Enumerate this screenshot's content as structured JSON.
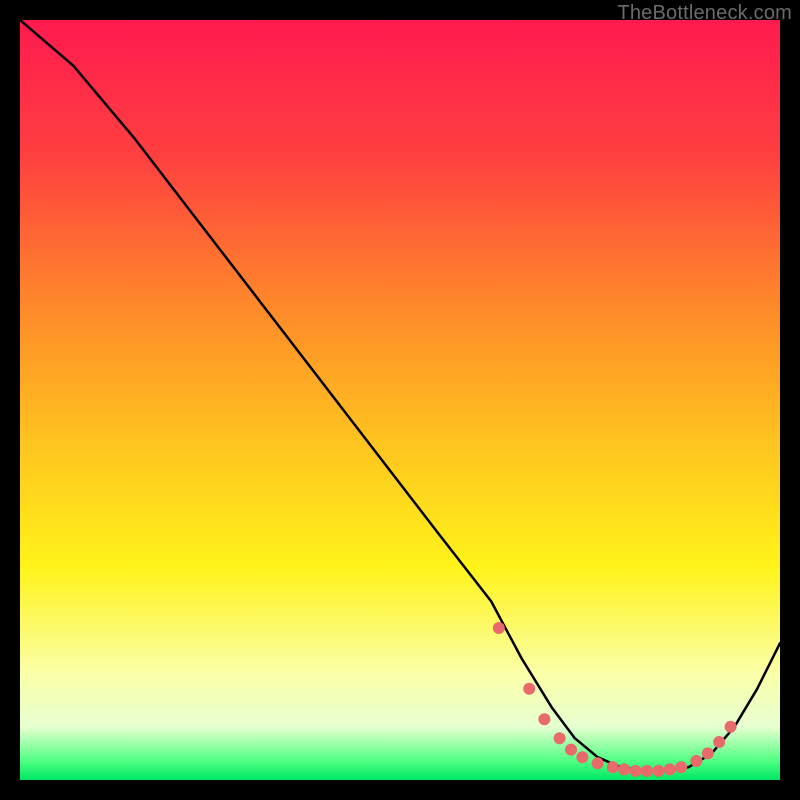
{
  "watermark": "TheBottleneck.com",
  "chart_data": {
    "type": "line",
    "title": "",
    "xlabel": "",
    "ylabel": "",
    "xlim": [
      0,
      100
    ],
    "ylim": [
      0,
      100
    ],
    "grid": false,
    "legend": false,
    "background_gradient": {
      "stops": [
        {
          "offset": 0.0,
          "color": "#ff1a4f"
        },
        {
          "offset": 0.18,
          "color": "#ff4040"
        },
        {
          "offset": 0.38,
          "color": "#ff8a2a"
        },
        {
          "offset": 0.55,
          "color": "#ffc21f"
        },
        {
          "offset": 0.72,
          "color": "#fff31a"
        },
        {
          "offset": 0.86,
          "color": "#fbffa8"
        },
        {
          "offset": 0.93,
          "color": "#e7ffd0"
        },
        {
          "offset": 0.975,
          "color": "#4fff82"
        },
        {
          "offset": 1.0,
          "color": "#00e765"
        }
      ]
    },
    "series": [
      {
        "name": "curve",
        "color": "#000000",
        "x": [
          0,
          7,
          15,
          25,
          35,
          45,
          55,
          62,
          66,
          70,
          73,
          76,
          79,
          82,
          85,
          88,
          91,
          94,
          97,
          100
        ],
        "y": [
          100,
          94,
          84.5,
          71.5,
          58.5,
          45.5,
          32.5,
          23.5,
          16,
          9.5,
          5.5,
          3,
          1.7,
          1.2,
          1.2,
          1.7,
          3.5,
          7,
          12,
          18
        ]
      }
    ],
    "markers": {
      "color": "#e86a6a",
      "radius_px": 6,
      "points": [
        {
          "x": 63,
          "y": 20
        },
        {
          "x": 67,
          "y": 12
        },
        {
          "x": 69,
          "y": 8
        },
        {
          "x": 71,
          "y": 5.5
        },
        {
          "x": 72.5,
          "y": 4
        },
        {
          "x": 74,
          "y": 3
        },
        {
          "x": 76,
          "y": 2.2
        },
        {
          "x": 78,
          "y": 1.7
        },
        {
          "x": 79.5,
          "y": 1.4
        },
        {
          "x": 81,
          "y": 1.2
        },
        {
          "x": 82.5,
          "y": 1.2
        },
        {
          "x": 84,
          "y": 1.2
        },
        {
          "x": 85.5,
          "y": 1.4
        },
        {
          "x": 87,
          "y": 1.7
        },
        {
          "x": 89,
          "y": 2.5
        },
        {
          "x": 90.5,
          "y": 3.5
        },
        {
          "x": 92,
          "y": 5
        },
        {
          "x": 93.5,
          "y": 7
        }
      ]
    }
  }
}
